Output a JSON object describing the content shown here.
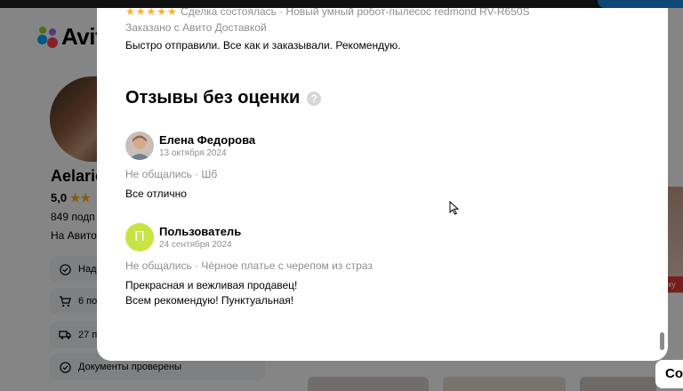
{
  "header": {
    "logo_text": "Avit"
  },
  "seller": {
    "name": "Aelariе",
    "rating": "5,0",
    "stars": "★★",
    "subscribers": "849 подп",
    "since": "На Авито",
    "badges": [
      {
        "text": "Надё",
        "icon": "check-circle-icon"
      },
      {
        "text": "6 по",
        "icon": "cart-icon"
      },
      {
        "text": "27 пр",
        "icon": "truck-icon"
      },
      {
        "text": "Документы проверены",
        "icon": "check-circle-icon"
      }
    ]
  },
  "background_right": {
    "sale_tag": "аку"
  },
  "modal": {
    "previous_review": {
      "stars": "★★★★★",
      "deal": "Сделка состоялась · Новый умный робот-пылесос redmond RV-R650S",
      "delivery": "Заказано с Авито Доставкой",
      "text": "Быстро отправили. Все как и заказывали. Рекомендую."
    },
    "section_title": "Отзывы без оценки",
    "help_icon": "?",
    "reviews": [
      {
        "name": "Елена Федорова",
        "date": "13 октября 2024",
        "meta": "Не общались · Шб",
        "text_lines": [
          "Все отлично"
        ],
        "avatar_type": "photo"
      },
      {
        "name": "Пользователь",
        "date": "24 сентября 2024",
        "meta": "Не общались · Чёрное платье с черепом из страз",
        "text_lines": [
          "Прекрасная и вежливая продавец!",
          "Всем рекомендую! Пунктуальная!"
        ],
        "avatar_letter": "П",
        "avatar_color": "#c7e445"
      }
    ]
  },
  "floating_button": {
    "label": "Со"
  },
  "colors": {
    "star": "#ffb021",
    "muted_text": "#8f8f8f",
    "badge_bg": "#f2f6fa"
  }
}
